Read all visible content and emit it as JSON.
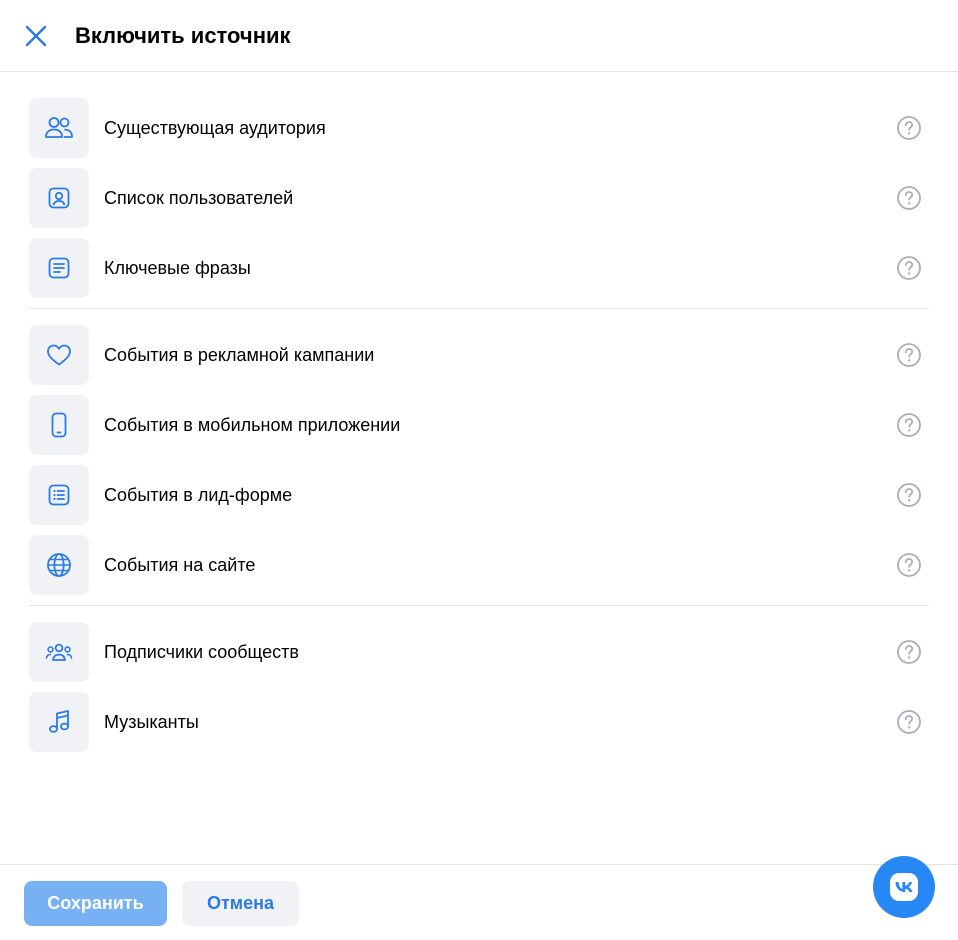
{
  "header": {
    "title": "Включить источник",
    "close_icon": "close-icon"
  },
  "colors": {
    "accent": "#2b7ae8",
    "icon_bg": "#f0f2f5",
    "help_icon": "#a8adb8",
    "save_button": "#78b1f3",
    "vk_brand": "#2787f5"
  },
  "groups": [
    {
      "items": [
        {
          "label": "Существующая аудитория",
          "icon": "audience-icon"
        },
        {
          "label": "Список пользователей",
          "icon": "user-list-icon"
        },
        {
          "label": "Ключевые фразы",
          "icon": "document-text-icon"
        }
      ]
    },
    {
      "items": [
        {
          "label": "События в рекламной кампании",
          "icon": "heart-icon"
        },
        {
          "label": "События в мобильном приложении",
          "icon": "smartphone-icon"
        },
        {
          "label": "События в лид-форме",
          "icon": "list-form-icon"
        },
        {
          "label": "События на сайте",
          "icon": "globe-icon"
        }
      ]
    },
    {
      "items": [
        {
          "label": "Подписчики сообществ",
          "icon": "community-icon"
        },
        {
          "label": "Музыканты",
          "icon": "music-note-icon"
        }
      ]
    }
  ],
  "footer": {
    "save_label": "Сохранить",
    "cancel_label": "Отмена",
    "vk_label": "VK"
  }
}
